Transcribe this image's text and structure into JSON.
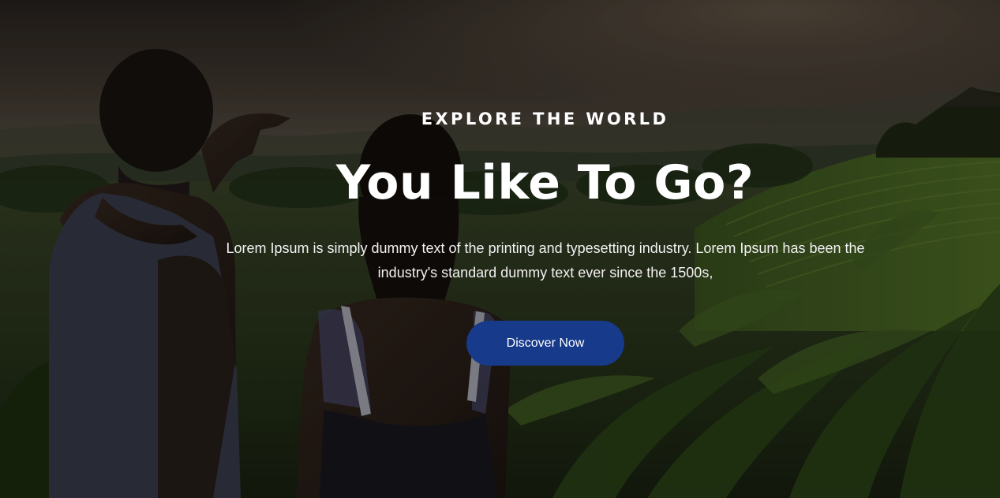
{
  "hero": {
    "eyebrow": "EXPLORE THE WORLD",
    "headline": "You Like To Go?",
    "description": "Lorem Ipsum is simply dummy text of the printing and typesetting industry. Lorem Ipsum has been the industry's standard dummy text ever since the 1500s,",
    "cta_label": "Discover Now"
  },
  "colors": {
    "cta_background": "#173a8a",
    "text": "#ffffff",
    "overlay": "#000000"
  },
  "background_image": "couple-overlooking-green-valley-photo"
}
